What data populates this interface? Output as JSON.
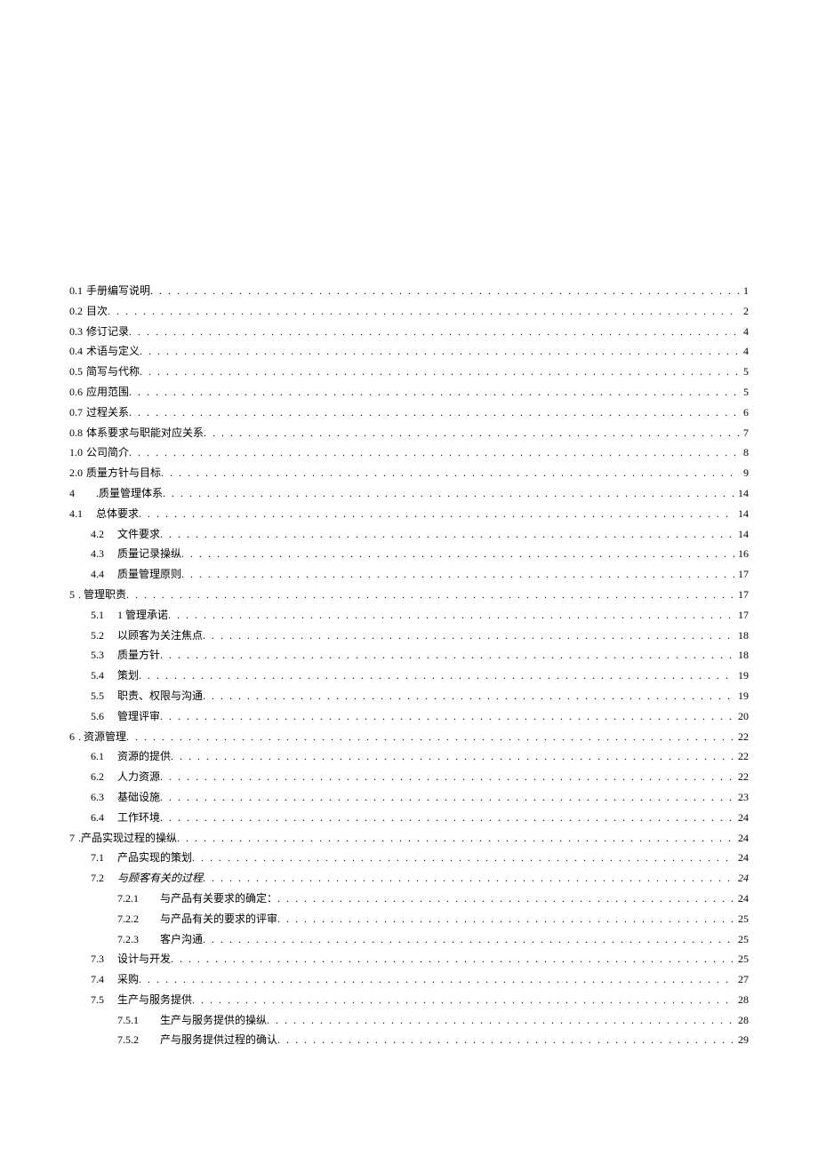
{
  "toc": [
    {
      "num": "0.1",
      "label": "手册编写说明",
      "page": "1",
      "lvl": 0,
      "group": "a"
    },
    {
      "num": "0.2",
      "label": "目次",
      "page": "2",
      "lvl": 0,
      "group": "a"
    },
    {
      "num": "0.3",
      "label": "修订记录",
      "page": "4",
      "lvl": 0,
      "group": "a"
    },
    {
      "num": "0.4",
      "label": "术语与定义",
      "page": "4",
      "lvl": 0,
      "group": "a"
    },
    {
      "num": "0.5",
      "label": "简写与代称",
      "page": "5",
      "lvl": 0,
      "group": "a"
    },
    {
      "num": "0.6",
      "label": "应用范围",
      "page": "5",
      "lvl": 0,
      "group": "a"
    },
    {
      "num": "0.7",
      "label": "过程关系",
      "page": "6",
      "lvl": 0,
      "group": "a"
    },
    {
      "num": "0.8",
      "label": "体系要求与职能对应关系",
      "page": "7",
      "lvl": 0,
      "group": "a"
    },
    {
      "num": "1.0",
      "label": "公司简介",
      "page": "8",
      "lvl": 0,
      "group": "a"
    },
    {
      "num": "2.0",
      "label": "质量方针与目标",
      "page": "9",
      "lvl": 0,
      "group": "a"
    },
    {
      "num": "4",
      "label": ".质量管理体系",
      "page": "14",
      "lvl": 0,
      "group": "b",
      "gap": true
    },
    {
      "num": "4.1",
      "label": "总体要求",
      "page": "14",
      "lvl": 0,
      "group": "b",
      "gap": true
    },
    {
      "num": "4.2",
      "label": "文件要求",
      "page": "14",
      "lvl": 1,
      "group": "b"
    },
    {
      "num": "4.3",
      "label": "质量记录操纵",
      "page": "16",
      "lvl": 1,
      "group": "b"
    },
    {
      "num": "4.4",
      "label": "质量管理原则",
      "page": "17",
      "lvl": 1,
      "group": "b"
    },
    {
      "num": "5",
      "label": ". 管理职责",
      "page": "17",
      "lvl": 0,
      "group": "b"
    },
    {
      "num": "5.1",
      "label": "1 管理承诺",
      "page": "17",
      "lvl": 1,
      "group": "b"
    },
    {
      "num": "5.2",
      "label": "以顾客为关注焦点",
      "page": "18",
      "lvl": 1,
      "group": "b"
    },
    {
      "num": "5.3",
      "label": "质量方针",
      "page": "18",
      "lvl": 1,
      "group": "b"
    },
    {
      "num": "5.4",
      "label": "策划",
      "page": "19",
      "lvl": 1,
      "group": "b"
    },
    {
      "num": "5.5",
      "label": "职责、权限与沟通",
      "page": "19",
      "lvl": 1,
      "group": "b"
    },
    {
      "num": "5.6",
      "label": "管理评审",
      "page": "20",
      "lvl": 1,
      "group": "b"
    },
    {
      "num": "6",
      "label": ". 资源管理",
      "page": "22",
      "lvl": 0,
      "group": "b"
    },
    {
      "num": "6.1",
      "label": "资源的提供",
      "page": "22",
      "lvl": 1,
      "group": "b"
    },
    {
      "num": "6.2",
      "label": "人力资源",
      "page": "22",
      "lvl": 1,
      "group": "b"
    },
    {
      "num": "6.3",
      "label": "基础设施",
      "page": "23",
      "lvl": 1,
      "group": "b"
    },
    {
      "num": "6.4",
      "label": "工作环境",
      "page": "24",
      "lvl": 1,
      "group": "b"
    },
    {
      "num": "7",
      "label": ".产品实现过程的操纵",
      "page": "24",
      "lvl": 0,
      "group": "b"
    },
    {
      "num": "7.1",
      "label": "产品实现的策划",
      "page": "24",
      "lvl": 1,
      "group": "b"
    },
    {
      "num": "7.2",
      "label": "与顾客有关的过程",
      "page": "24",
      "lvl": 1,
      "group": "b",
      "italic": true
    },
    {
      "num": "7.2.1",
      "label": "与产品有关要求的确定：",
      "page": "24",
      "lvl": 2,
      "group": "b"
    },
    {
      "num": "7.2.2",
      "label": "与产品有关的要求的评审",
      "page": "25",
      "lvl": 2,
      "group": "b"
    },
    {
      "num": "7.2.3",
      "label": "客户沟通",
      "page": "25",
      "lvl": 2,
      "group": "b"
    },
    {
      "num": "7.3",
      "label": "设计与开发",
      "page": "25",
      "lvl": 1,
      "group": "b"
    },
    {
      "num": "7.4",
      "label": "采购",
      "page": "27",
      "lvl": 1,
      "group": "b"
    },
    {
      "num": "7.5",
      "label": "生产与服务提供",
      "page": "28",
      "lvl": 1,
      "group": "b"
    },
    {
      "num": "7.5.1",
      "label": "生产与服务提供的操纵",
      "page": "28",
      "lvl": 2,
      "group": "b"
    },
    {
      "num": "7.5.2",
      "label": "产与服务提供过程的确认",
      "page": "29",
      "lvl": 2,
      "group": "b"
    }
  ]
}
